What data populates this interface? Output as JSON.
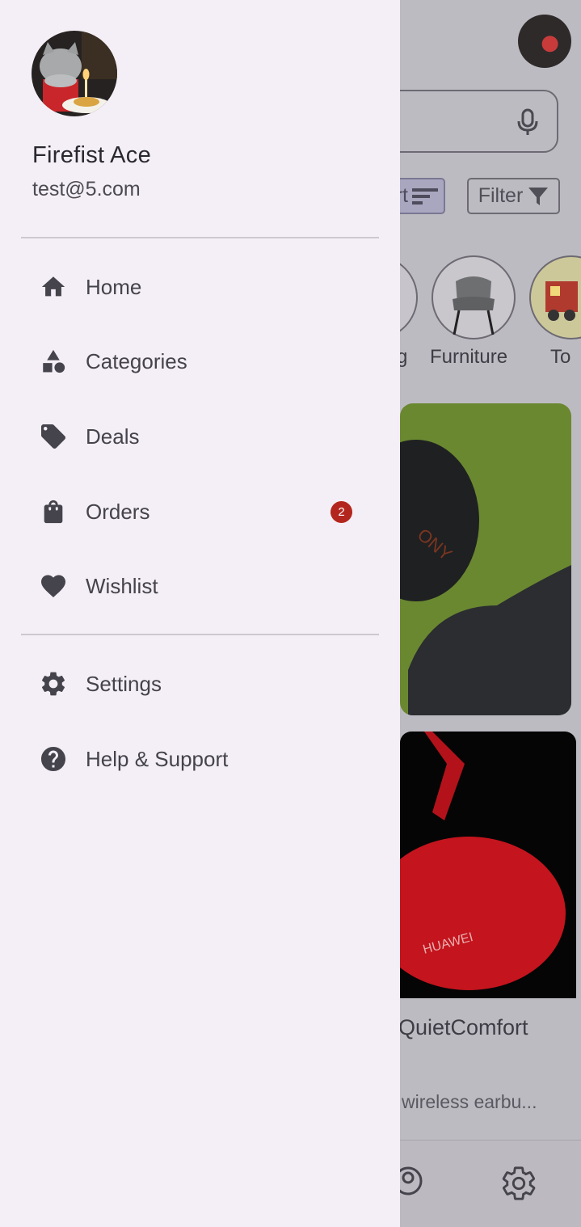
{
  "drawer": {
    "profile": {
      "name": "Firefist Ace",
      "email": "test@5.com",
      "avatar": "user-avatar-cat-with-candle"
    },
    "menu": [
      {
        "label": "Home",
        "icon": "home-icon"
      },
      {
        "label": "Categories",
        "icon": "categories-icon"
      },
      {
        "label": "Deals",
        "icon": "tag-icon"
      },
      {
        "label": "Orders",
        "icon": "shopping-bag-icon",
        "badge": "2"
      },
      {
        "label": "Wishlist",
        "icon": "heart-icon"
      }
    ],
    "secondary_menu": [
      {
        "label": "Settings",
        "icon": "gear-icon"
      },
      {
        "label": "Help & Support",
        "icon": "help-icon"
      }
    ]
  },
  "background": {
    "sort_label": "rt",
    "filter_label": "Filter",
    "categories": [
      {
        "label": "g"
      },
      {
        "label": "Furniture"
      },
      {
        "label": "To"
      }
    ],
    "product": {
      "title": "QuietComfort",
      "description": "wireless earbu..."
    }
  },
  "colors": {
    "drawer_bg": "#f4eff6",
    "badge": "#b3261e",
    "icon": "#45434b"
  }
}
